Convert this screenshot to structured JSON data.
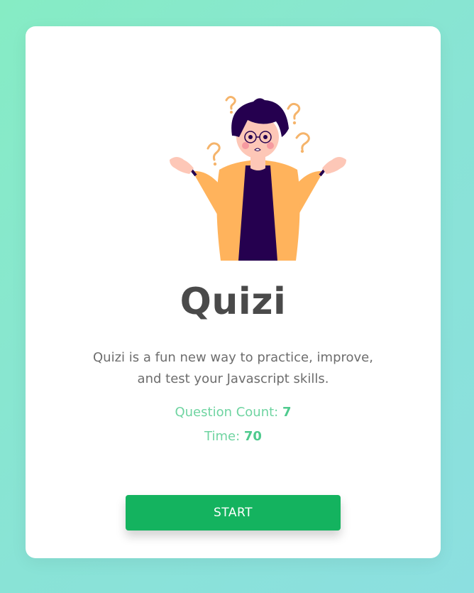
{
  "app": {
    "title": "Quizi",
    "description": "Quizi is a fun new way to practice, improve, and test your Javascript skills."
  },
  "stats": {
    "question_count_label": "Question Count:",
    "question_count_value": "7",
    "time_label": "Time:",
    "time_value": "70"
  },
  "actions": {
    "start_label": "START"
  },
  "illustration": {
    "icon": "confused-person-shrugging-with-question-marks"
  },
  "colors": {
    "background_start": "#86ecc4",
    "background_end": "#8cdfe0",
    "card": "#ffffff",
    "title": "#4a4a4a",
    "stat_text": "#6fd4a1",
    "button": "#14b35f",
    "jacket": "#ffb35c",
    "hair": "#25004f"
  }
}
